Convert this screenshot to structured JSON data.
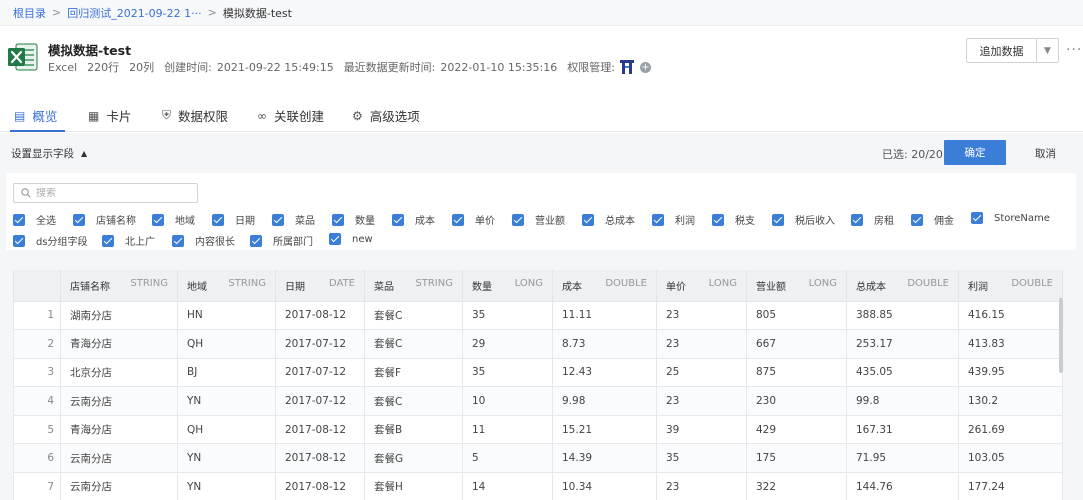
{
  "breadcrumb": {
    "root": "根目录",
    "parent": "回归测试_2021-09-22 1···",
    "current": "模拟数据-test"
  },
  "file": {
    "title": "模拟数据-test",
    "type": "Excel",
    "rows": "220行",
    "cols": "20列",
    "created_label": "创建时间:",
    "created": "2021-09-22 15:49:15",
    "updated_label": "最近数据更新时间:",
    "updated": "2022-01-10 15:35:16",
    "perm_label": "权限管理:",
    "add_perm": "+"
  },
  "actions": {
    "add_data": "追加数据",
    "more": "···"
  },
  "tabs": [
    {
      "label": "概览",
      "icon": "overview-icon"
    },
    {
      "label": "卡片",
      "icon": "card-icon"
    },
    {
      "label": "数据权限",
      "icon": "shield-icon"
    },
    {
      "label": "关联创建",
      "icon": "link-icon"
    },
    {
      "label": "高级选项",
      "icon": "gear-icon"
    }
  ],
  "field_panel": {
    "title": "设置显示字段",
    "selected": "已选: 20/20",
    "confirm": "确定",
    "cancel": "取消",
    "search_placeholder": "搜索",
    "fields": [
      "全选",
      "店铺名称",
      "地域",
      "日期",
      "菜品",
      "数量",
      "成本",
      "单价",
      "营业额",
      "总成本",
      "利润",
      "税支",
      "税后收入",
      "房租",
      "佣金",
      "StoreName",
      "ds分组字段",
      "北上广",
      "内容很长",
      "所属部门",
      "new"
    ]
  },
  "table": {
    "columns": [
      {
        "name": "店铺名称",
        "type": "STRING"
      },
      {
        "name": "地域",
        "type": "STRING"
      },
      {
        "name": "日期",
        "type": "DATE"
      },
      {
        "name": "菜品",
        "type": "STRING"
      },
      {
        "name": "数量",
        "type": "LONG"
      },
      {
        "name": "成本",
        "type": "DOUBLE"
      },
      {
        "name": "单价",
        "type": "LONG"
      },
      {
        "name": "营业额",
        "type": "LONG"
      },
      {
        "name": "总成本",
        "type": "DOUBLE"
      },
      {
        "name": "利润",
        "type": "DOUBLE"
      }
    ],
    "rows": [
      [
        "1",
        "湖南分店",
        "HN",
        "2017-08-12",
        "套餐C",
        "35",
        "11.11",
        "23",
        "805",
        "388.85",
        "416.15"
      ],
      [
        "2",
        "青海分店",
        "QH",
        "2017-07-12",
        "套餐C",
        "29",
        "8.73",
        "23",
        "667",
        "253.17",
        "413.83"
      ],
      [
        "3",
        "北京分店",
        "BJ",
        "2017-07-12",
        "套餐F",
        "35",
        "12.43",
        "25",
        "875",
        "435.05",
        "439.95"
      ],
      [
        "4",
        "云南分店",
        "YN",
        "2017-07-12",
        "套餐C",
        "10",
        "9.98",
        "23",
        "230",
        "99.8",
        "130.2"
      ],
      [
        "5",
        "青海分店",
        "QH",
        "2017-08-12",
        "套餐B",
        "11",
        "15.21",
        "39",
        "429",
        "167.31",
        "261.69"
      ],
      [
        "6",
        "云南分店",
        "YN",
        "2017-08-12",
        "套餐G",
        "5",
        "14.39",
        "35",
        "175",
        "71.95",
        "103.05"
      ],
      [
        "7",
        "云南分店",
        "YN",
        "2017-08-12",
        "套餐H",
        "14",
        "10.34",
        "23",
        "322",
        "144.76",
        "177.24"
      ]
    ]
  },
  "colors": {
    "accent": "#3a7ed8",
    "link": "#3a6fd8",
    "excel": "#1f7a45"
  }
}
